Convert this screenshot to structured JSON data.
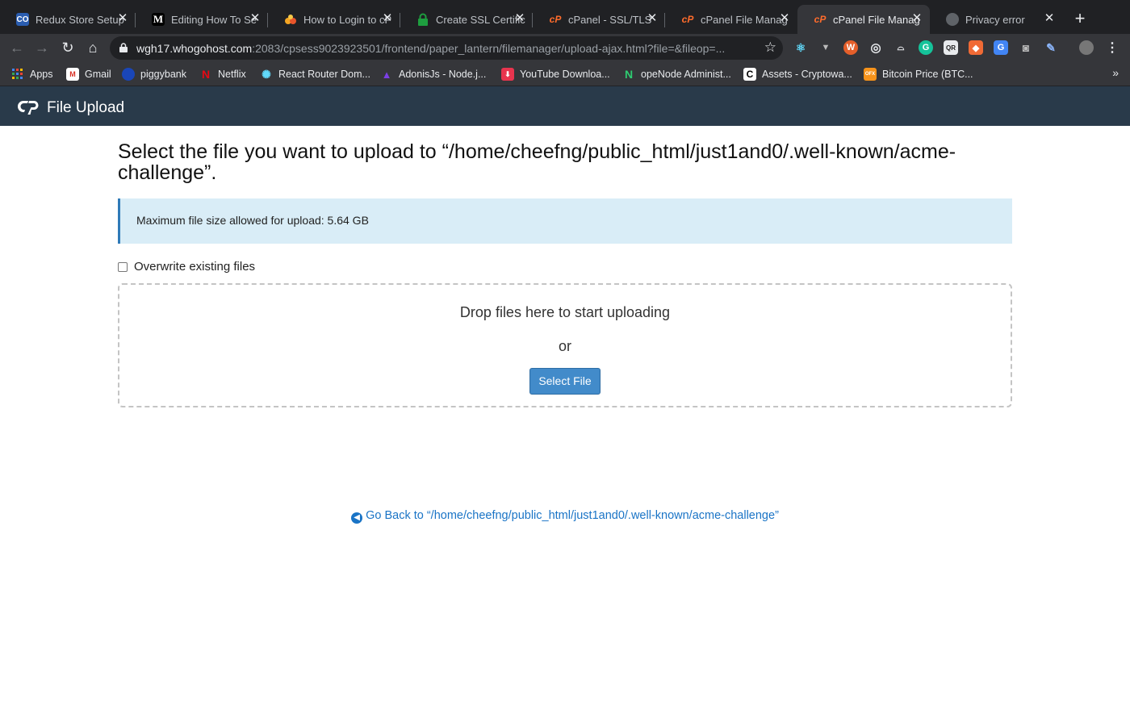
{
  "browser": {
    "tabs": [
      {
        "title": "Redux Store Setup",
        "icon": "codesandbox-icon",
        "active": false
      },
      {
        "title": "Editing How To Se",
        "icon": "medium-icon",
        "active": false
      },
      {
        "title": "How to Login to cP",
        "icon": "blog-icon",
        "active": false
      },
      {
        "title": "Create SSL Certific",
        "icon": "lock-icon",
        "active": false
      },
      {
        "title": "cPanel - SSL/TLS",
        "icon": "cpanel-icon",
        "active": false
      },
      {
        "title": "cPanel File Manag",
        "icon": "cpanel-icon",
        "active": false
      },
      {
        "title": "cPanel File Manag",
        "icon": "cpanel-icon",
        "active": true
      },
      {
        "title": "Privacy error",
        "icon": "globe-icon",
        "active": false
      }
    ],
    "url_host": "wgh17.whogohost.com",
    "url_rest": ":2083/cpsess9023923501/frontend/paper_lantern/filemanager/upload-ajax.html?file=&fileop=...",
    "bookmarks": [
      {
        "label": "Apps",
        "icon": "apps-grid-icon"
      },
      {
        "label": "Gmail",
        "icon": "gmail-icon"
      },
      {
        "label": "piggybank",
        "icon": "piggybank-icon"
      },
      {
        "label": "Netflix",
        "icon": "netflix-icon"
      },
      {
        "label": "React Router Dom...",
        "icon": "react-icon"
      },
      {
        "label": "AdonisJs - Node.j...",
        "icon": "adonis-icon"
      },
      {
        "label": "YouTube Downloa...",
        "icon": "download-icon"
      },
      {
        "label": "opeNode Administ...",
        "icon": "openode-icon"
      },
      {
        "label": "Assets - Cryptowa...",
        "icon": "c-icon"
      },
      {
        "label": "Bitcoin Price (BTC...",
        "icon": "bitcoin-icon"
      }
    ],
    "bookmarks_more": "»"
  },
  "header": {
    "title": "File Upload"
  },
  "main": {
    "heading": "Select the file you want to upload to “/home/cheefng/public_html/just1and0/.well-known/acme-challenge”.",
    "max_size_text": "Maximum file size allowed for upload: 5.64 GB",
    "overwrite_label": "Overwrite existing files",
    "overwrite_checked": false,
    "drop_text": "Drop files here to start uploading",
    "or_text": "or",
    "select_button": "Select File",
    "go_back": "Go Back to “/home/cheefng/public_html/just1and0/.well-known/acme-challenge”"
  },
  "colors": {
    "header_bg": "#293a4a",
    "info_bg": "#d9edf7",
    "info_border": "#2f7ab8",
    "button_bg": "#428bca",
    "link": "#1a74c6"
  }
}
